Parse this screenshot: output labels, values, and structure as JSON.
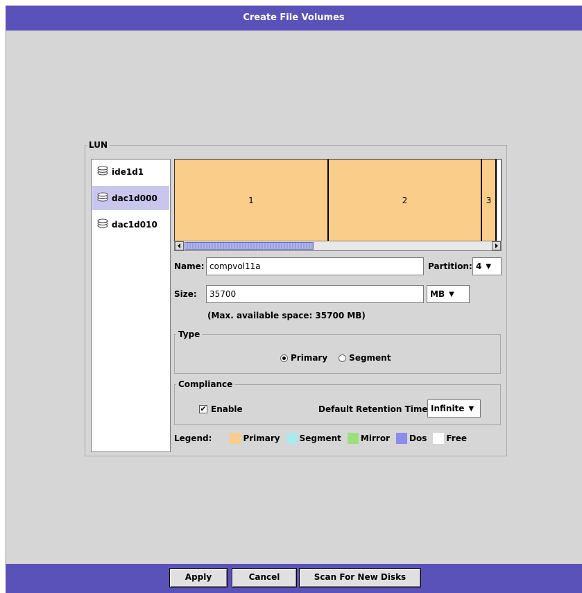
{
  "window": {
    "title": "Create File Volumes"
  },
  "lun": {
    "group_label": "LUN",
    "items": [
      {
        "label": "ide1d1",
        "icon": "disk-stack-icon",
        "selected": false
      },
      {
        "label": "dac1d000",
        "icon": "disk-stack-icon",
        "selected": true
      },
      {
        "label": "dac1d010",
        "icon": "disk-stack-icon",
        "selected": false
      }
    ]
  },
  "partitions": {
    "segments": [
      {
        "label": "1",
        "color": "#fbcd8b"
      },
      {
        "label": "2",
        "color": "#fbcd8b"
      },
      {
        "label": "3",
        "color": "#fbcd8b"
      }
    ]
  },
  "form": {
    "name_label": "Name:",
    "name_value": "compvol11a",
    "partition_label": "Partition:",
    "partition_value": "4",
    "size_label": "Size:",
    "size_value": "35700",
    "size_unit": "MB",
    "max_space_text": "(Max. available space: 35700 MB)"
  },
  "type": {
    "group_label": "Type",
    "primary_label": "Primary",
    "segment_label": "Segment",
    "selected": "Primary"
  },
  "compliance": {
    "group_label": "Compliance",
    "enable_label": "Enable",
    "enable_checked": true,
    "retention_label": "Default Retention Time",
    "retention_value": "Infinite"
  },
  "legend": {
    "label": "Legend:",
    "items": [
      {
        "label": "Primary",
        "color": "#fbcd8b"
      },
      {
        "label": "Segment",
        "color": "#a9e9ef"
      },
      {
        "label": "Mirror",
        "color": "#9be07a"
      },
      {
        "label": "Dos",
        "color": "#8b8bf0"
      },
      {
        "label": "Free",
        "color": "#ffffff"
      }
    ]
  },
  "buttons": {
    "apply": "Apply",
    "cancel": "Cancel",
    "scan": "Scan For New Disks"
  },
  "colors": {
    "titlebar": "#5a52b8",
    "background": "#d6d6d6",
    "selection": "#c9c6ee"
  }
}
